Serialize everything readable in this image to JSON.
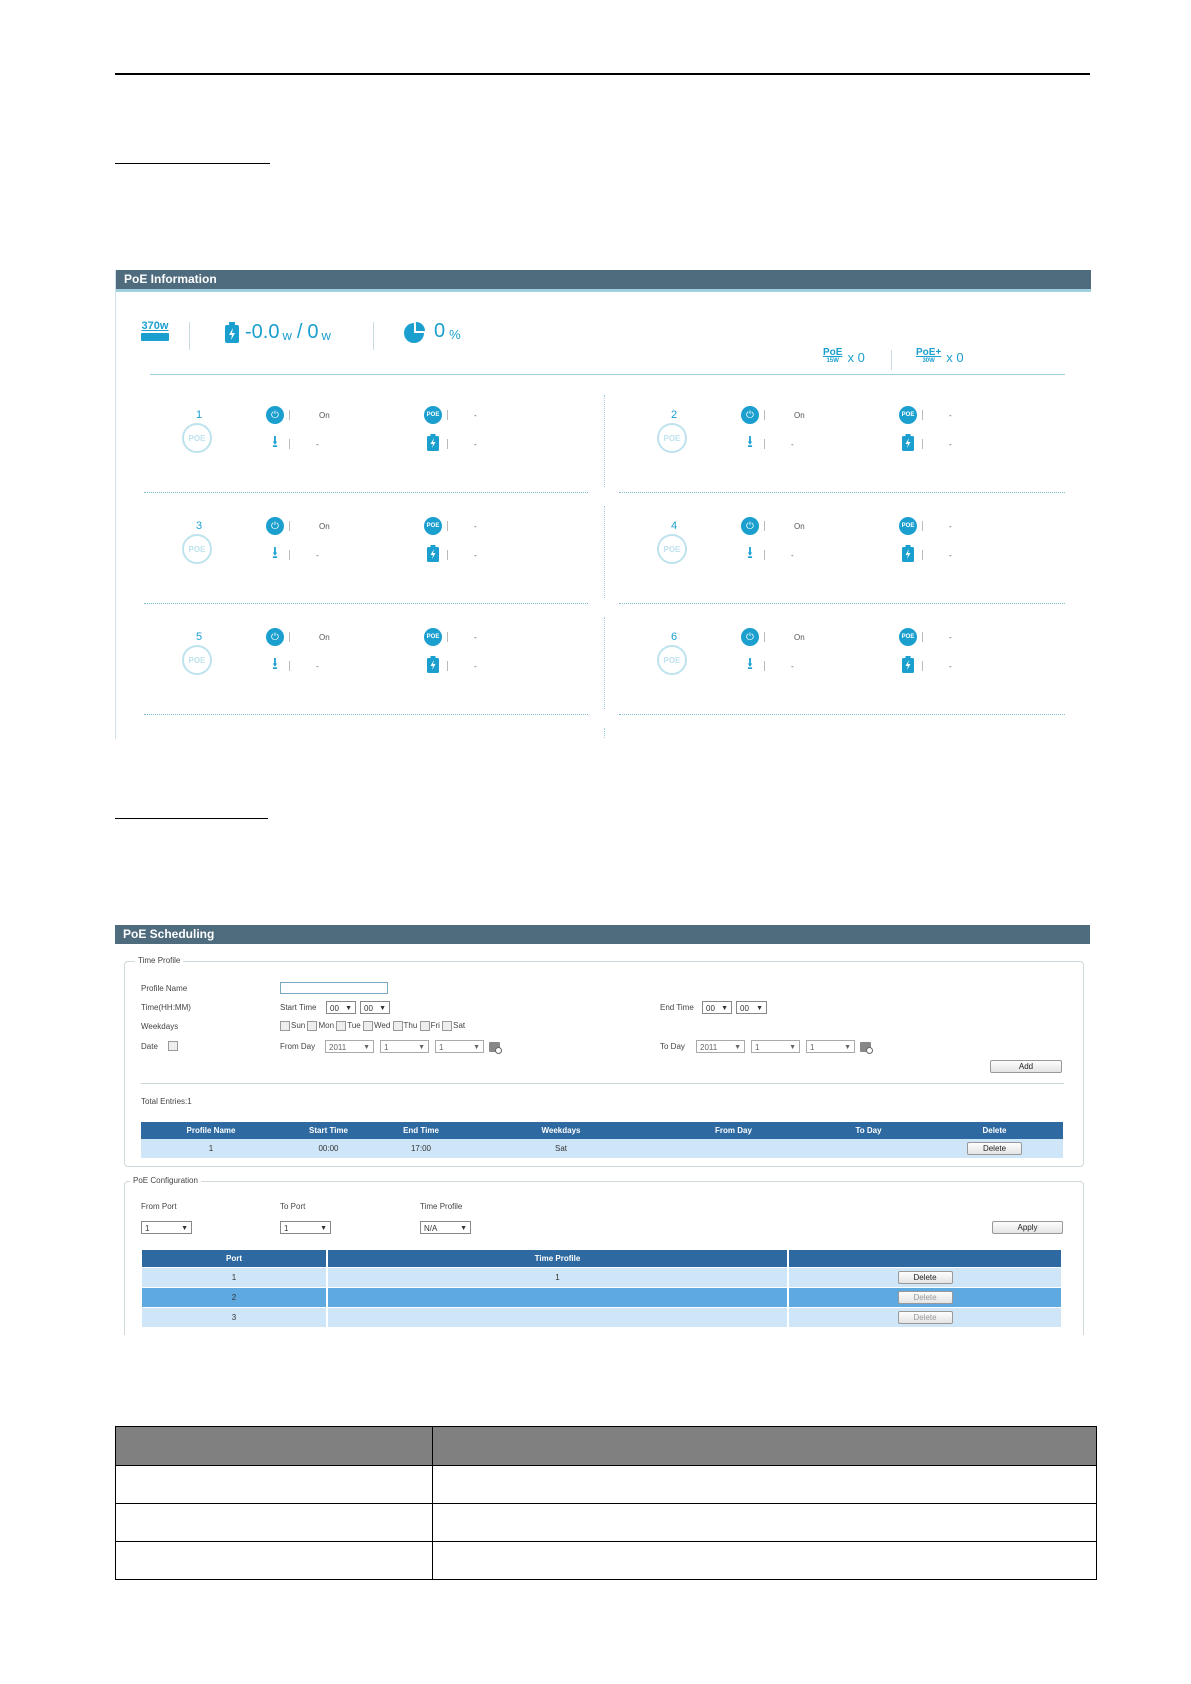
{
  "poe_info": {
    "title": "PoE Information",
    "budget": "370w",
    "power_value": "-0.0",
    "power_unit1": "w",
    "power_sep": "/",
    "power_budget": "0",
    "power_unit2": "w",
    "usage_value": "0",
    "usage_unit": "%",
    "poe_15w": {
      "label": "PoE",
      "sub": "15W",
      "count": "x 0"
    },
    "poe_30w": {
      "label": "PoE+",
      "sub": "30W",
      "count": "x 0"
    },
    "ports": [
      {
        "num": "1",
        "state": "On",
        "class": "-",
        "priority": "-",
        "power": "-"
      },
      {
        "num": "2",
        "state": "On",
        "class": "-",
        "priority": "-",
        "power": "-"
      },
      {
        "num": "3",
        "state": "On",
        "class": "-",
        "priority": "-",
        "power": "-"
      },
      {
        "num": "4",
        "state": "On",
        "class": "-",
        "priority": "-",
        "power": "-"
      },
      {
        "num": "5",
        "state": "On",
        "class": "-",
        "priority": "-",
        "power": "-"
      },
      {
        "num": "6",
        "state": "On",
        "class": "-",
        "priority": "-",
        "power": "-"
      }
    ],
    "ring_text": "POE",
    "badge_text": "POE"
  },
  "poe_sched": {
    "title": "PoE Scheduling",
    "time_profile": {
      "legend": "Time Profile",
      "profile_name_label": "Profile Name",
      "profile_name_value": "",
      "time_label": "Time(HH:MM)",
      "start_time_label": "Start Time",
      "start_hh": "00",
      "start_mm": "00",
      "end_time_label": "End Time",
      "end_hh": "00",
      "end_mm": "00",
      "weekdays_label": "Weekdays",
      "days": [
        "Sun",
        "Mon",
        "Tue",
        "Wed",
        "Thu",
        "Fri",
        "Sat"
      ],
      "date_label": "Date",
      "from_day_label": "From Day",
      "from_year": "2011",
      "from_month": "1",
      "from_day": "1",
      "to_day_label": "To Day",
      "to_year": "2011",
      "to_month": "1",
      "to_day": "1",
      "add_button": "Add",
      "total_entries": "Total Entries:1",
      "columns": [
        "Profile Name",
        "Start Time",
        "End Time",
        "Weekdays",
        "From Day",
        "To Day",
        "Delete"
      ],
      "rows": [
        {
          "profile": "1",
          "start": "00:00",
          "end": "17:00",
          "weekdays": "Sat",
          "from": "",
          "to": "",
          "delete": "Delete"
        }
      ]
    },
    "poe_config": {
      "legend": "PoE Configuration",
      "from_port_label": "From Port",
      "from_port_value": "1",
      "to_port_label": "To Port",
      "to_port_value": "1",
      "time_profile_label": "Time Profile",
      "time_profile_value": "N/A",
      "apply_button": "Apply",
      "columns": [
        "Port",
        "Time Profile",
        ""
      ],
      "rows": [
        {
          "port": "1",
          "profile": "1",
          "delete": "Delete"
        },
        {
          "port": "2",
          "profile": "",
          "delete": "Delete"
        },
        {
          "port": "3",
          "profile": "",
          "delete": "Delete"
        }
      ]
    }
  },
  "desc_table": {
    "headers": [
      "",
      ""
    ],
    "rows": [
      [
        "",
        ""
      ],
      [
        "",
        ""
      ],
      [
        "",
        ""
      ]
    ]
  }
}
